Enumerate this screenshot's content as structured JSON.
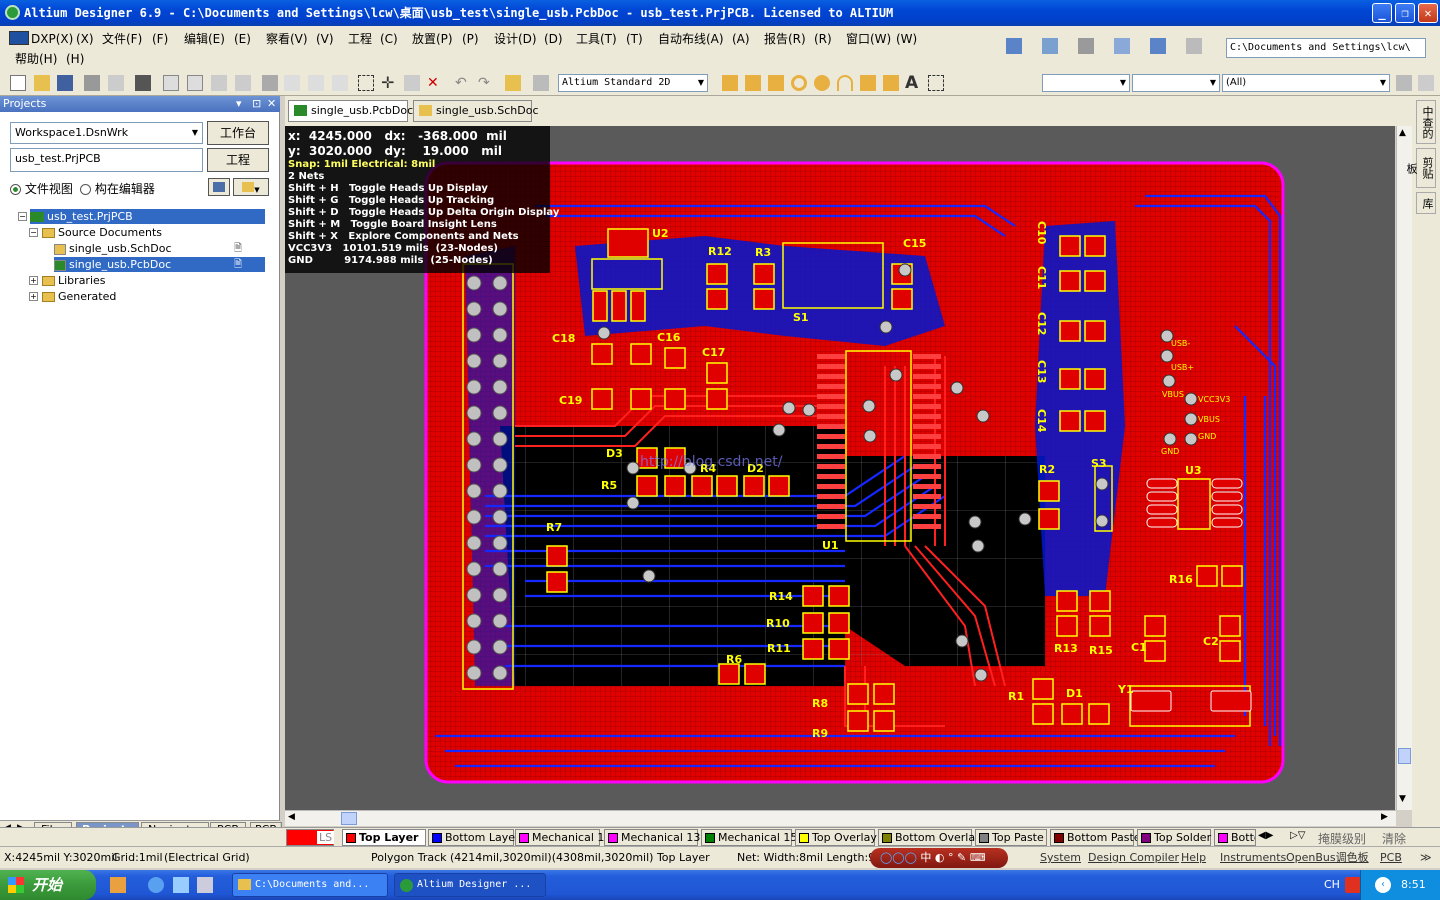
{
  "window": {
    "title": "Altium Designer 6.9 - C:\\Documents and Settings\\lcw\\桌面\\usb_test\\single_usb.PcbDoc - usb_test.PrjPCB. Licensed to ALTIUM"
  },
  "menu": {
    "items": [
      "DXP(X)",
      "(X)",
      "文件(F)",
      "(F)",
      "编辑(E)",
      "(E)",
      "察看(V)",
      "(V)",
      "工程",
      "(C)",
      "放置(P)",
      "(P)",
      "设计(D)",
      "(D)",
      "工具(T)",
      "(T)",
      "自动布线(A)",
      "(A)",
      "报告(R)",
      "(R)",
      "窗口(W)",
      "(W)"
    ],
    "help": "帮助(H)",
    "help2": "(H)"
  },
  "toolbar": {
    "path": "C:\\Documents and Settings\\lcw\\",
    "view_mode": "Altium Standard 2D",
    "filter_all": "(All)"
  },
  "panel": {
    "title": "Projects",
    "workspace": "Workspace1.DsnWrk",
    "workspace_btn": "工作台",
    "project": "usb_test.PrjPCB",
    "project_btn": "工程",
    "radio_file_view": "文件视图",
    "radio_struct_editor": "构在编辑器",
    "tree": {
      "root": "usb_test.PrjPCB",
      "source_docs": "Source Documents",
      "schdoc": "single_usb.SchDoc",
      "pcbdoc": "single_usb.PcbDoc",
      "libraries": "Libraries",
      "generated": "Generated"
    },
    "bottom_tabs": [
      "Files",
      "Projects",
      "Navigator",
      "PCB",
      "PCB"
    ]
  },
  "doc_tabs": [
    "single_usb.PcbDoc",
    "single_usb.SchDoc"
  ],
  "hud": {
    "x": "x:  4245.000",
    "dx": "dx:   -368.000  mil",
    "y": "y:  3020.000",
    "dy": "dy:    19.000   mil",
    "snap": "Snap: 1mil Electrical: 8mil",
    "nets": "2 Nets",
    "sh_h": "Shift + H   Toggle Heads Up Display",
    "sh_g": "Shift + G   Toggle Heads Up Tracking",
    "sh_d": "Shift + D   Toggle Heads Up Delta Origin Display",
    "sh_m": "Shift + M   Toggle Board Insight Lens",
    "sh_x": "Shift + X   Explore Components and Nets",
    "net1": "VCC3V3   10101.519 mils  (23-Nodes)",
    "net2": "GND         9174.988 mils  (25-Nodes)"
  },
  "pcb": {
    "labels": [
      "U2",
      "R12",
      "R3",
      "C15",
      "S1",
      "C18",
      "C16",
      "C17",
      "C19",
      "D3",
      "R5",
      "R4",
      "D2",
      "R7",
      "R14",
      "R10",
      "R11",
      "R6",
      "R8",
      "R9",
      "U1",
      "C10",
      "C11",
      "C12",
      "C13",
      "C14",
      "R2",
      "S3",
      "U3",
      "R16",
      "R13",
      "R15",
      "C1",
      "C2",
      "R1",
      "D1",
      "Y1",
      "USB-",
      "USB+",
      "VBUS",
      "VCC3V3",
      "VBUS",
      "GND",
      "GND"
    ],
    "watermark": "http://blog.csdn.net/"
  },
  "layers": [
    {
      "name": "LS",
      "color": "#ff0000"
    },
    {
      "name": "Top Layer",
      "color": "#ff0000"
    },
    {
      "name": "Bottom Layer",
      "color": "#0000ff"
    },
    {
      "name": "Mechanical 1",
      "color": "#ff00ff"
    },
    {
      "name": "Mechanical 13",
      "color": "#ff00ff"
    },
    {
      "name": "Mechanical 15",
      "color": "#008000"
    },
    {
      "name": "Top Overlay",
      "color": "#ffff00"
    },
    {
      "name": "Bottom Overlay",
      "color": "#808000"
    },
    {
      "name": "Top Paste",
      "color": "#808080"
    },
    {
      "name": "Bottom Paste",
      "color": "#800000"
    },
    {
      "name": "Top Solder",
      "color": "#800080"
    },
    {
      "name": "Botto",
      "color": "#ff00ff"
    }
  ],
  "layer_right": {
    "mask": "掩膜级别",
    "clear": "清除"
  },
  "status": {
    "coords": "X:4245mil Y:3020mil",
    "grid": "Grid:1mil",
    "grid_type": "(Electrical Grid)",
    "info": "Polygon Track (4214mil,3020mil)(4308mil,3020mil)  Top Layer",
    "net": "Net: Width:8mil Length:94mi",
    "right": [
      "System",
      "Design Compiler",
      "Help",
      "Instruments",
      "OpenBus调色板",
      "PCB"
    ]
  },
  "taskbar": {
    "start": "开始",
    "tasks": [
      "C:\\Documents and...",
      "Altium Designer ..."
    ],
    "ime": "CH",
    "clock": "8:51"
  },
  "right_tabs": [
    "中查的",
    "剪贴板",
    "库"
  ]
}
